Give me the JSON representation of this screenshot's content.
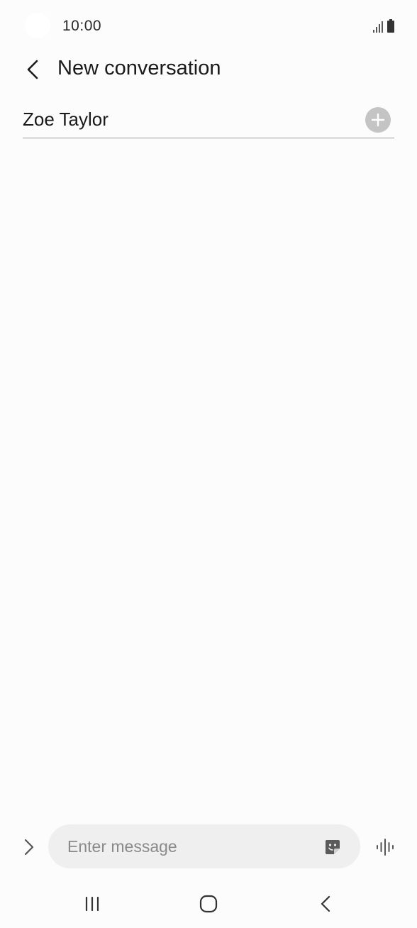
{
  "status_bar": {
    "time": "10:00"
  },
  "header": {
    "title": "New conversation",
    "back_icon": "chevron-left-icon"
  },
  "recipient": {
    "value": "Zoe Taylor",
    "add_icon": "plus-circle-icon"
  },
  "composer": {
    "placeholder": "Enter message",
    "expand_icon": "chevron-right-icon",
    "sticker_icon": "sticker-icon",
    "voice_icon": "voice-waveform-icon"
  },
  "nav_bar": {
    "recents_icon": "recents-icon",
    "home_icon": "home-icon",
    "back_icon": "back-icon"
  },
  "colors": {
    "background": "#fcfcfc",
    "input_fill": "#efefef",
    "divider": "#9a9a9a",
    "add_button": "#c4c4c4",
    "icon": "#5a5a5a"
  }
}
